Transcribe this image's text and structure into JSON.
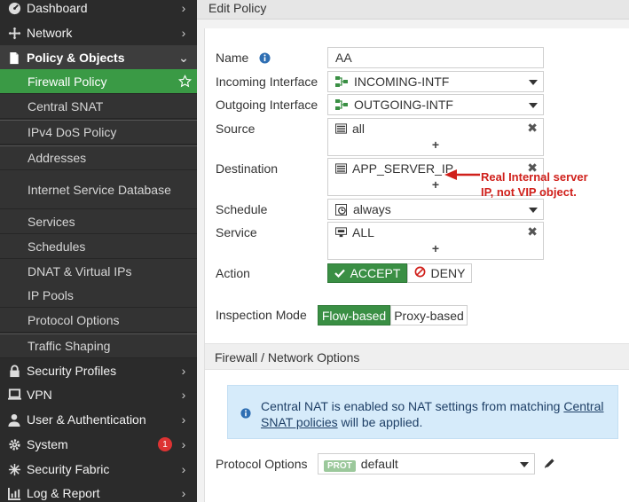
{
  "sidebar": {
    "items": [
      {
        "label": "Dashboard",
        "icon": "dashboard-icon"
      },
      {
        "label": "Network",
        "icon": "network-icon"
      },
      {
        "label": "Policy & Objects",
        "icon": "policy-icon"
      }
    ],
    "policy_sub": [
      {
        "label": "Firewall Policy"
      },
      {
        "label": "Central SNAT"
      },
      {
        "label": "IPv4 DoS Policy"
      },
      {
        "label": "Addresses"
      },
      {
        "label": "Internet Service Database"
      },
      {
        "label": "Services"
      },
      {
        "label": "Schedules"
      },
      {
        "label": "DNAT & Virtual IPs"
      },
      {
        "label": "IP Pools"
      },
      {
        "label": "Protocol Options"
      },
      {
        "label": "Traffic Shaping"
      }
    ],
    "bottom": [
      {
        "label": "Security Profiles",
        "icon": "lock-icon"
      },
      {
        "label": "VPN",
        "icon": "monitor-icon"
      },
      {
        "label": "User & Authentication",
        "icon": "user-icon"
      },
      {
        "label": "System",
        "icon": "gear-icon",
        "badge": "1"
      },
      {
        "label": "Security Fabric",
        "icon": "fabric-icon"
      },
      {
        "label": "Log & Report",
        "icon": "chart-icon"
      }
    ]
  },
  "page": {
    "title": "Edit Policy"
  },
  "form": {
    "name_label": "Name",
    "name_value": "AA",
    "incoming_label": "Incoming Interface",
    "incoming_value": "INCOMING-INTF",
    "outgoing_label": "Outgoing Interface",
    "outgoing_value": "OUTGOING-INTF",
    "source_label": "Source",
    "source_value": "all",
    "destination_label": "Destination",
    "destination_value": "APP_SERVER_IP",
    "schedule_label": "Schedule",
    "schedule_value": "always",
    "service_label": "Service",
    "service_value": "ALL",
    "action_label": "Action",
    "accept_label": "ACCEPT",
    "deny_label": "DENY",
    "inspection_label": "Inspection Mode",
    "flow_label": "Flow-based",
    "proxy_label": "Proxy-based",
    "plus": "+",
    "remove": "✖"
  },
  "annotation": {
    "line1": "Real Internal server",
    "line2": "IP, not VIP object."
  },
  "section": {
    "title": "Firewall / Network Options"
  },
  "info": {
    "text_before": "Central NAT is enabled so NAT settings from matching ",
    "link": "Central SNAT policies",
    "text_after": " will be applied."
  },
  "protocol": {
    "label": "Protocol Options",
    "tag": "PROT",
    "value": "default"
  },
  "colors": {
    "accent": "#3a8f44",
    "sidebar": "#2b2b2b",
    "info_bg": "#d6ebfa",
    "annotation": "#d0201b"
  }
}
